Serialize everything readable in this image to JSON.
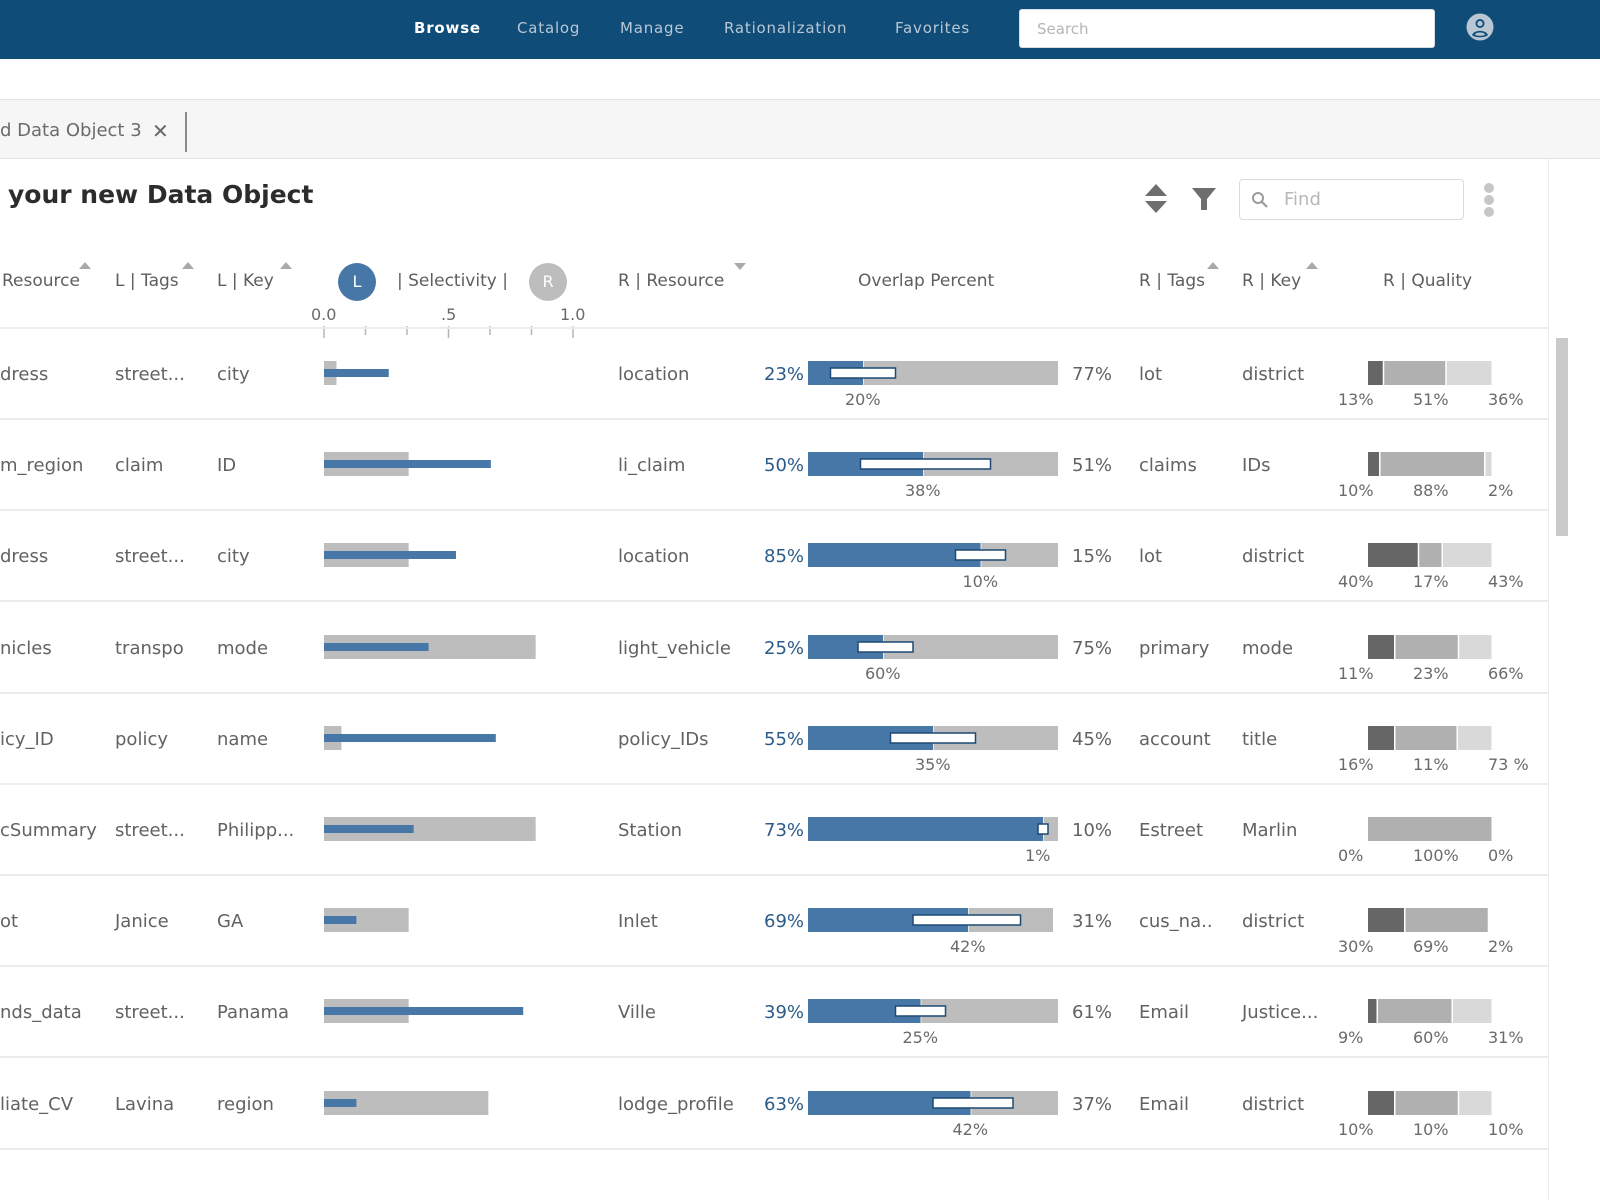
{
  "nav": {
    "items": [
      {
        "label": "Browse",
        "active": true
      },
      {
        "label": "Catalog",
        "active": false
      },
      {
        "label": "Manage",
        "active": false
      },
      {
        "label": "Rationalization",
        "active": false
      },
      {
        "label": "Favorites",
        "active": false
      }
    ],
    "search_placeholder": "Search",
    "user_icon": "user-circle-icon"
  },
  "tab": {
    "label": "d Data Object 3",
    "close_glyph": "✕"
  },
  "page": {
    "title": "your new Data Object",
    "find_placeholder": "Find",
    "icons": [
      "sort-icon",
      "filter-icon",
      "search-icon",
      "more-vertical-icon"
    ]
  },
  "colors": {
    "nav_bg": "#0f4c78",
    "accent_blue": "#4677a7",
    "text_blue": "#2b5b88",
    "bar_gray": "#bdbdbd",
    "quality_dark": "#666666",
    "quality_mid": "#b0b0b0",
    "quality_light": "#d9d9d9"
  },
  "columns": {
    "l_resource": "Resource",
    "l_tags": "L | Tags",
    "l_key": "L | Key",
    "selectivity": "| Selectivity |",
    "badge_l": "L",
    "badge_r": "R",
    "r_resource": "R | Resource",
    "overlap": "Overlap Percent",
    "r_tags": "R | Tags",
    "r_key": "R | Key",
    "r_quality": "R | Quality"
  },
  "selectivity_axis": {
    "labels": [
      "0.0",
      ".5",
      "1.0"
    ],
    "range": [
      0,
      1
    ],
    "tick_count": 7
  },
  "rows": [
    {
      "l_resource": "dress",
      "l_tags": "street...",
      "l_key": "city",
      "sel_r": 0.05,
      "sel_l": 0.26,
      "r_resource": "location",
      "overlap_left": "23%",
      "overlap_right": "77%",
      "overlap_mid": "20%",
      "ov_fill": 0.22,
      "ov_box": [
        0.09,
        0.35
      ],
      "ov_track": 1.0,
      "r_tags": "lot",
      "r_key": "district",
      "quality": [
        0.13,
        0.5,
        0.37
      ],
      "quality_labels": [
        "13%",
        "51%",
        "36%"
      ]
    },
    {
      "l_resource": "m_region",
      "l_tags": "claim",
      "l_key": "ID",
      "sel_r": 0.34,
      "sel_l": 0.67,
      "r_resource": "li_claim",
      "overlap_left": "50%",
      "overlap_right": "51%",
      "overlap_mid": "38%",
      "ov_fill": 0.46,
      "ov_box": [
        0.21,
        0.73
      ],
      "ov_track": 1.0,
      "r_tags": "claims",
      "r_key": "IDs",
      "quality": [
        0.1,
        0.84,
        0.06
      ],
      "quality_labels": [
        "10%",
        "88%",
        "2%"
      ]
    },
    {
      "l_resource": "dress",
      "l_tags": "street...",
      "l_key": "city",
      "sel_r": 0.34,
      "sel_l": 0.53,
      "r_resource": "location",
      "overlap_left": "85%",
      "overlap_right": "15%",
      "overlap_mid": "10%",
      "ov_fill": 0.69,
      "ov_box": [
        0.59,
        0.79
      ],
      "ov_track": 1.0,
      "r_tags": "lot",
      "r_key": "district",
      "quality": [
        0.41,
        0.19,
        0.4
      ],
      "quality_labels": [
        "40%",
        "17%",
        "43%"
      ]
    },
    {
      "l_resource": "nicles",
      "l_tags": "transpo",
      "l_key": "mode",
      "sel_r": 0.85,
      "sel_l": 0.42,
      "r_resource": "light_vehicle",
      "overlap_left": "25%",
      "overlap_right": "75%",
      "overlap_mid": "60%",
      "ov_fill": 0.3,
      "ov_box": [
        0.2,
        0.42
      ],
      "ov_track": 1.0,
      "r_tags": "primary",
      "r_key": "mode",
      "quality": [
        0.22,
        0.51,
        0.27
      ],
      "quality_labels": [
        "11%",
        "23%",
        "66%"
      ]
    },
    {
      "l_resource": "icy_ID",
      "l_tags": "policy",
      "l_key": "name",
      "sel_r": 0.07,
      "sel_l": 0.69,
      "r_resource": "policy_IDs",
      "overlap_left": "55%",
      "overlap_right": "45%",
      "overlap_mid": "35%",
      "ov_fill": 0.5,
      "ov_box": [
        0.33,
        0.67
      ],
      "ov_track": 1.0,
      "r_tags": "account",
      "r_key": "title",
      "quality": [
        0.22,
        0.5,
        0.28
      ],
      "quality_labels": [
        "16%",
        "11%",
        "73 %"
      ]
    },
    {
      "l_resource": "cSummary",
      "l_tags": "street...",
      "l_key": "Philipp...",
      "sel_r": 0.85,
      "sel_l": 0.36,
      "r_resource": "Station",
      "overlap_left": "73%",
      "overlap_right": "10%",
      "overlap_mid": "1%",
      "ov_fill": 0.94,
      "ov_box": [
        0.92,
        0.96
      ],
      "ov_track": 1.0,
      "r_tags": "Estreet",
      "r_key": "Marlin",
      "quality": [
        0.0,
        1.0,
        0.0
      ],
      "quality_labels": [
        "0%",
        "100%",
        "0%"
      ]
    },
    {
      "l_resource": "ot",
      "l_tags": "Janice",
      "l_key": "GA",
      "sel_r": 0.34,
      "sel_l": 0.13,
      "r_resource": "Inlet",
      "overlap_left": "69%",
      "overlap_right": "31%",
      "overlap_mid": "42%",
      "ov_fill": 0.64,
      "ov_box": [
        0.42,
        0.85
      ],
      "ov_track": 0.98,
      "r_tags": "cus_na..",
      "r_key": "district",
      "quality": [
        0.3,
        0.67,
        0.0
      ],
      "quality_labels": [
        "30%",
        "69%",
        "2%"
      ]
    },
    {
      "l_resource": "nds_data",
      "l_tags": "street...",
      "l_key": "Panama",
      "sel_r": 0.34,
      "sel_l": 0.8,
      "r_resource": "Ville",
      "overlap_left": "39%",
      "overlap_right": "61%",
      "overlap_mid": "25%",
      "ov_fill": 0.45,
      "ov_box": [
        0.35,
        0.55
      ],
      "ov_track": 1.0,
      "r_tags": "Email",
      "r_key": "Justice...",
      "quality": [
        0.08,
        0.6,
        0.32
      ],
      "quality_labels": [
        "9%",
        "60%",
        "31%"
      ]
    },
    {
      "l_resource": "liate_CV",
      "l_tags": "Lavina",
      "l_key": "region",
      "sel_r": 0.66,
      "sel_l": 0.13,
      "r_resource": "lodge_profile",
      "overlap_left": "63%",
      "overlap_right": "37%",
      "overlap_mid": "42%",
      "ov_fill": 0.65,
      "ov_box": [
        0.5,
        0.82
      ],
      "ov_track": 1.0,
      "r_tags": "Email",
      "r_key": "district",
      "quality": [
        0.22,
        0.51,
        0.27
      ],
      "quality_labels": [
        "10%",
        "10%",
        "10%"
      ]
    }
  ]
}
